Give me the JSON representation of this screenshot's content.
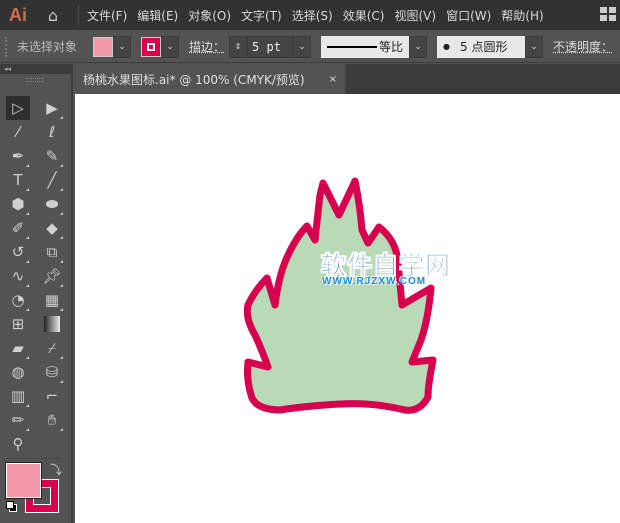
{
  "app": {
    "logo": "Ai",
    "menus": [
      "文件(F)",
      "编辑(E)",
      "对象(O)",
      "文字(T)",
      "选择(S)",
      "效果(C)",
      "视图(V)",
      "窗口(W)",
      "帮助(H)"
    ]
  },
  "control": {
    "selection_status": "未选择对象",
    "fill_color": "#f29aaa",
    "stroke_color": "#d6004f",
    "stroke_label": "描边：",
    "stroke_weight": "5 pt",
    "profile": "等比",
    "brush": "5 点圆形",
    "opacity_label": "不透明度："
  },
  "document": {
    "tab_title": "杨桃水果图标.ai* @ 100% (CMYK/预览)",
    "close": "×"
  },
  "tools": [
    "selection",
    "direct-selection",
    "magic-wand",
    "lasso",
    "pen",
    "curvature",
    "type",
    "line",
    "polygon",
    "ellipse",
    "paintbrush",
    "eraser",
    "rotate",
    "scale",
    "warp",
    "pin",
    "shape-builder",
    "perspective-grid",
    "mesh",
    "gradient",
    "measure",
    "eyedropper",
    "blend",
    "symbol-sprayer",
    "column-graph",
    "artboard",
    "slice",
    "hand",
    "zoom"
  ],
  "artwork": {
    "fill": "#b8dab6",
    "stroke": "#d6004f"
  },
  "watermark": {
    "title": "软件自学网",
    "url": "WWW.RJZXW.COM"
  }
}
